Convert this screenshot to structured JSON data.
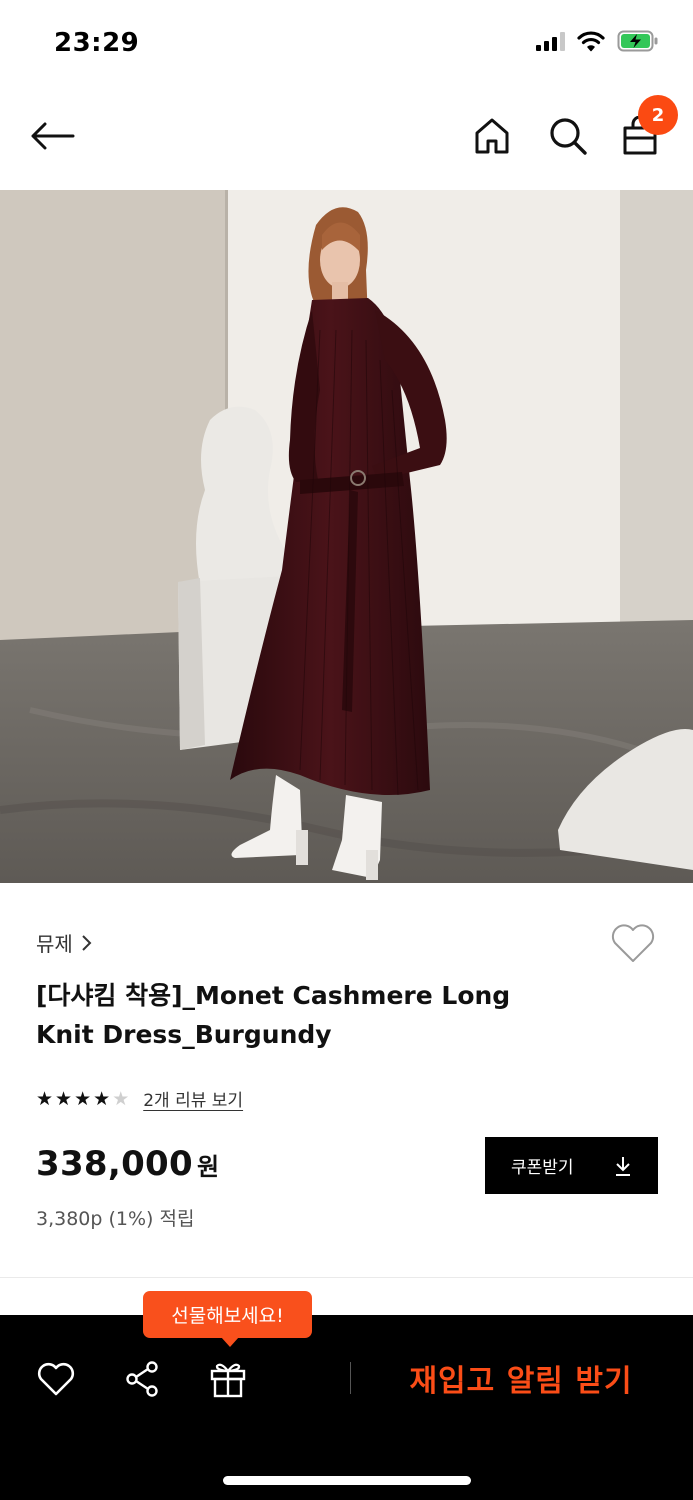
{
  "status": {
    "time": "23:29"
  },
  "nav": {
    "back_icon": "arrow-left-icon",
    "home_icon": "home-icon",
    "search_icon": "search-icon",
    "cart_icon": "shopping-bag-icon",
    "cart_count": "2"
  },
  "product": {
    "brand": "뮤제",
    "title_line1": "[다샤킴 착용]_Monet Cashmere Long",
    "title_line2": "Knit Dress_Burgundy",
    "rating": 4,
    "rating_max": 5,
    "review_link": "2개 리뷰 보기",
    "price": "338,000",
    "currency": "원",
    "points": "3,380p (1%) 적립",
    "coupon_label": "쿠폰받기"
  },
  "bottom_bar": {
    "gift_tooltip": "선물해보세요!",
    "restock_label": "재입고 알림 받기"
  },
  "colors": {
    "accent": "#fb4a12",
    "dress": "#3a0f14",
    "bar_bg": "#000000"
  }
}
